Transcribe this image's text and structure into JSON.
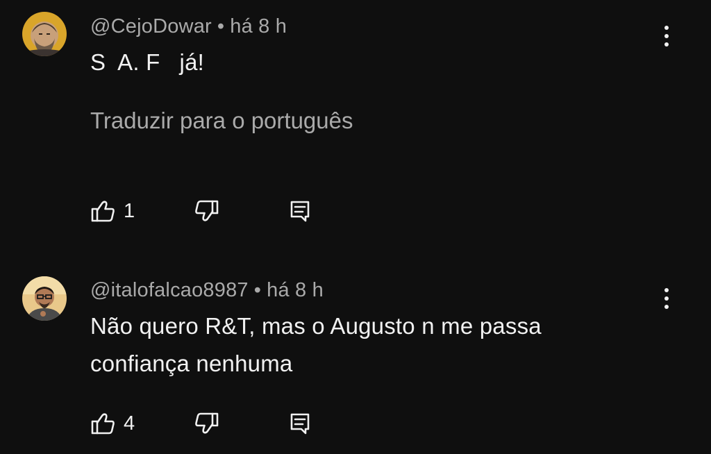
{
  "colors": {
    "background": "#0f0f0f",
    "text_primary": "#f1f1f1",
    "text_secondary": "#aaaaaa"
  },
  "comments": [
    {
      "author": "@CejoDowar",
      "separator": "•",
      "time": "há 8 h",
      "text": "S  A. F   já!",
      "translate_link": "Traduzir para o português",
      "like_count": "1",
      "icons": {
        "avatar": "avatar-bearded-man",
        "more": "more-vertical-icon",
        "like": "thumbs-up-icon",
        "dislike": "thumbs-down-icon",
        "reply": "reply-comment-icon"
      }
    },
    {
      "author": "@italofalcao8987",
      "separator": "•",
      "time": "há 8 h",
      "text": "Não quero R&T, mas o Augusto n me passa confiança nenhuma",
      "like_count": "4",
      "icons": {
        "avatar": "avatar-man-glasses",
        "more": "more-vertical-icon",
        "like": "thumbs-up-icon",
        "dislike": "thumbs-down-icon",
        "reply": "reply-comment-icon"
      }
    }
  ]
}
